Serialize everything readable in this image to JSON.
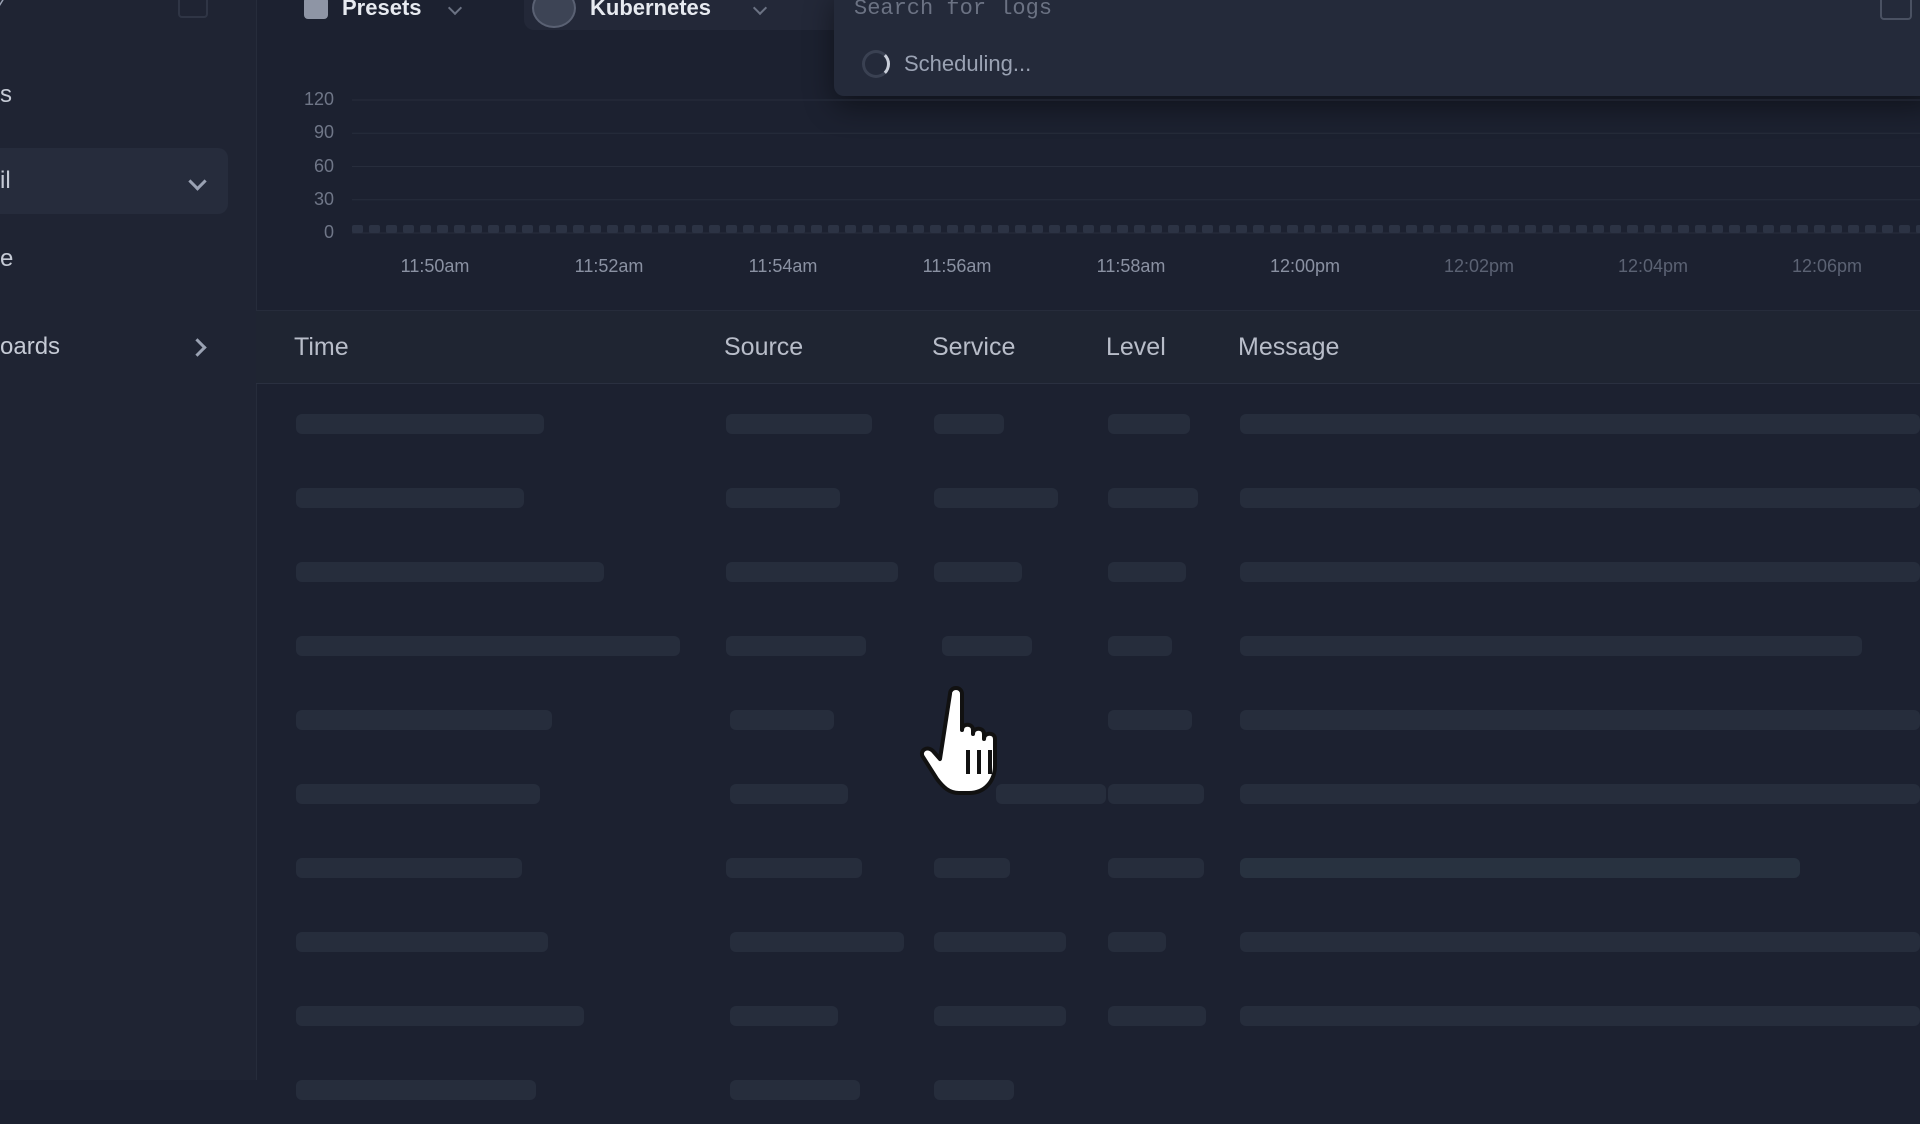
{
  "sidebar": {
    "items": [
      {
        "label": "s",
        "chevron": null
      },
      {
        "label": "il",
        "chevron": "down",
        "active": true
      },
      {
        "label": "e",
        "chevron": null
      },
      {
        "label": "oards",
        "chevron": "right"
      }
    ]
  },
  "toolbar": {
    "presets_label": "Presets",
    "source_label": "Kubernetes",
    "search_placeholder": "Search for logs",
    "status_text": "Scheduling..."
  },
  "chart_data": {
    "type": "bar",
    "y_ticks": [
      "120",
      "90",
      "60",
      "30",
      "0"
    ],
    "ylim": [
      0,
      120
    ],
    "x_ticks": [
      "11:50am",
      "11:52am",
      "11:54am",
      "11:56am",
      "11:58am",
      "12:00pm",
      "12:02pm",
      "12:04pm",
      "12:06pm"
    ],
    "grid": true
  },
  "table": {
    "columns": [
      "Time",
      "Source",
      "Service",
      "Level",
      "Message"
    ]
  },
  "colors": {
    "background": "#1c2130",
    "sidebar": "#1f2433",
    "panel": "#242a3a",
    "placeholder": "#262d3c"
  },
  "icons": {
    "presets": "presets-icon",
    "source": "kubernetes-icon",
    "copy": "copy-icon",
    "loading": "spinner-icon",
    "cursor": "hand-cursor-icon"
  }
}
